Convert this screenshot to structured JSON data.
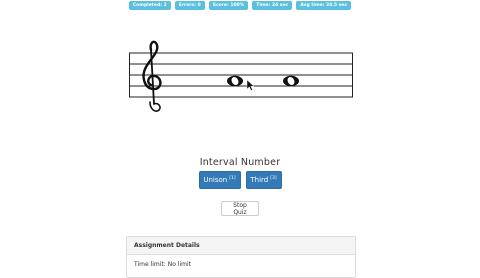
{
  "stats": {
    "completed": "Completed: 2",
    "errors": "Errors: 0",
    "score": "Score: 100%",
    "time": "Time: 24 sec",
    "avg_time": "Avg time: 24.5 sec",
    "badge_color": "#5bc0de"
  },
  "staff": {
    "clef": "treble-clef",
    "notes": [
      "whole-note",
      "whole-note"
    ]
  },
  "question": {
    "label": "Interval Number"
  },
  "answers": [
    {
      "label": "Unison",
      "shortcut": "[1]"
    },
    {
      "label": "Third",
      "shortcut": "[3]"
    }
  ],
  "stop_button": "Stop Quiz",
  "assignment": {
    "heading": "Assignment Details",
    "time_limit_label": "Time limit:",
    "time_limit_value": "No limit"
  },
  "colors": {
    "primary_button": "#337ab7"
  }
}
